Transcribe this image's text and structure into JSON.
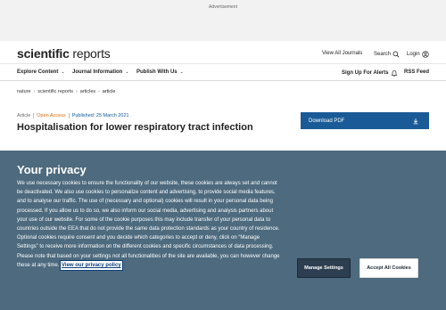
{
  "advertisement": {
    "label": "Advertisement"
  },
  "header": {
    "logo_bold": "scientific",
    "logo_light": " reports",
    "view_all_journals": "View All Journals",
    "search_label": "Search",
    "search_icon": "search-icon",
    "login_label": "Login",
    "login_icon": "user-icon"
  },
  "subnav": {
    "items": [
      {
        "label": "Explore Content",
        "icon": "chevron-down-icon"
      },
      {
        "label": "Journal Information",
        "icon": "chevron-down-icon"
      },
      {
        "label": "Publish With Us",
        "icon": "chevron-down-icon"
      }
    ],
    "signup_alerts": "Sign Up For Alerts",
    "bell_icon": "bell-icon",
    "rss_feed": "RSS Feed"
  },
  "breadcrumb": {
    "items": [
      "nature",
      "scientific reports",
      "articles",
      "article"
    ],
    "separator": "›"
  },
  "article": {
    "type": "Article",
    "access": "Open Access",
    "published": "Published: 25 March 2021",
    "title": "Hospitalisation for lower respiratory tract infection"
  },
  "download": {
    "label": "Download PDF",
    "icon": "download-icon"
  },
  "privacy": {
    "title": "Your privacy",
    "body": "We use necessary cookies to ensure the functionality of our website, these cookies are always set and cannot be deactivated. We also use cookies to personalize content and advertising, to provide social media features, and to analyse our traffic. The use of (necessary and optional) cookies will result in your personal data being processed. If you allow us to do so, we also inform our social media, advertising and analysis partners about your use of our website. For some of the cookie purposes this may include transfer of your personal data to countries outside the EEA that do not provide the same data protection standards as your country of residence. Optional cookies require consent and you decide which categories to accept or deny, click on “Manage Settings” to receive more information on the different cookies and specific circumstances of data processing. Please note that based on your settings not all functionalities of the site are available, you can however change these at any time.",
    "policy_link": "View our privacy policy",
    "manage_button": "Manage Settings",
    "accept_button": "Accept All Cookies"
  },
  "colors": {
    "download_bg": "#1a5b97",
    "privacy_bg": "#4d6a7e",
    "open_access": "#e06c0b",
    "published": "#0c5ca0",
    "manage_bg": "#2c3e50"
  }
}
